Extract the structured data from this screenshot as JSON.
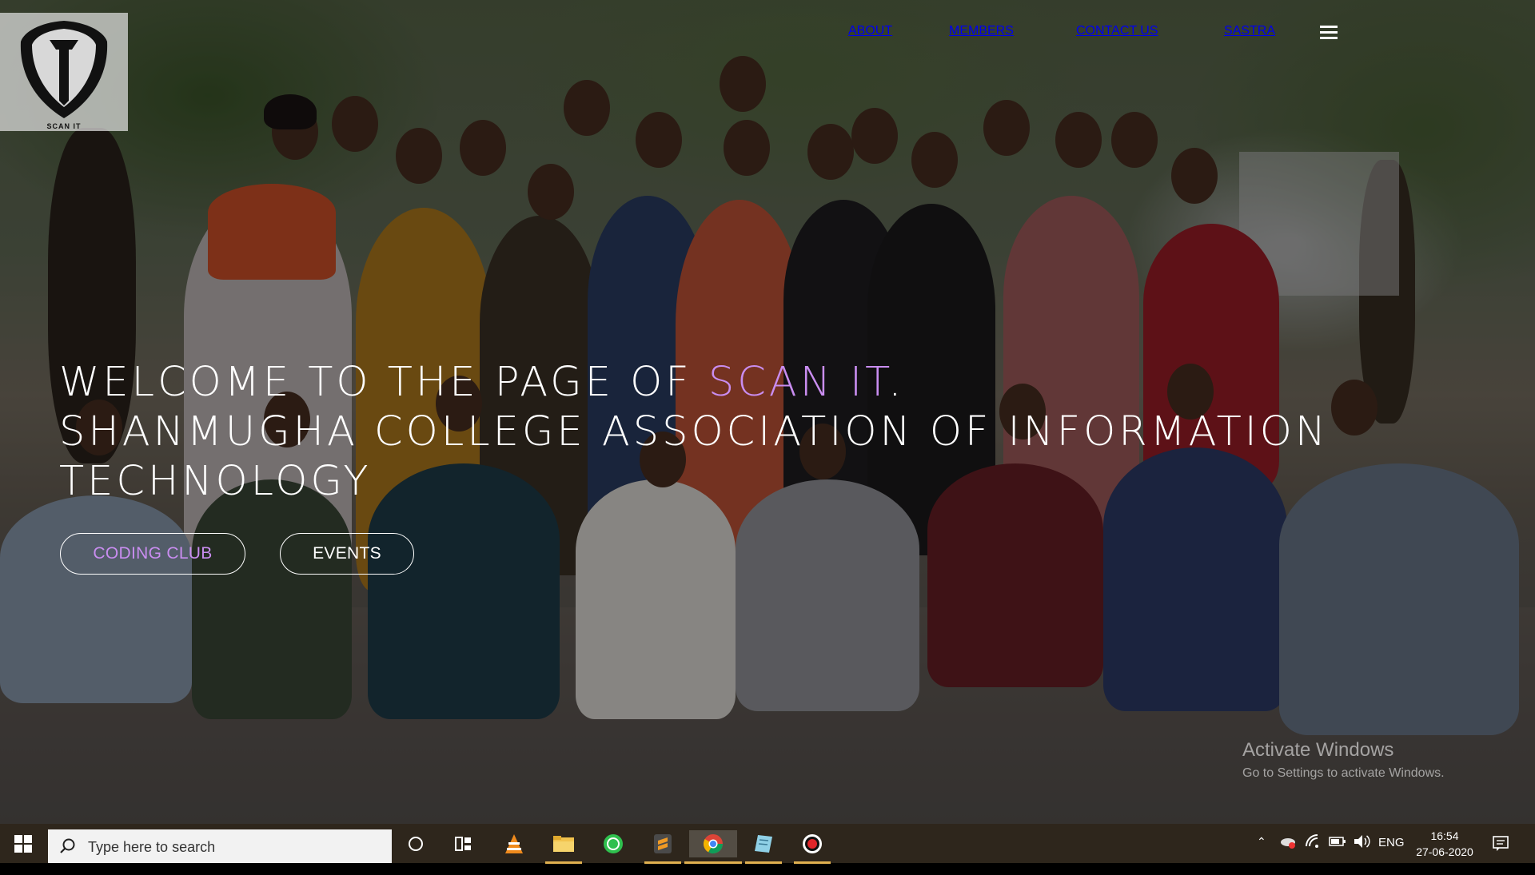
{
  "logo": {
    "text": "SCAN IT",
    "icon": "shield-logo-icon"
  },
  "nav": {
    "items": [
      {
        "label": "ABOUT"
      },
      {
        "label": "MEMBERS"
      },
      {
        "label": "CONTACT US"
      },
      {
        "label": "SASTRA"
      }
    ],
    "menu_icon": "hamburger-menu-icon"
  },
  "hero": {
    "line1_prefix": "WELCOME TO THE PAGE OF ",
    "line1_accent": "SCAN IT",
    "line1_suffix": ".",
    "line2": "SHANMUGHA COLLEGE ASSOCIATION OF INFORMATION",
    "line3": "TECHNOLOGY",
    "accent_color": "#c98df0",
    "buttons": {
      "coding": "CODING CLUB",
      "events": "EVENTS"
    }
  },
  "watermark": {
    "title": "Activate Windows",
    "subtitle": "Go to Settings to activate Windows."
  },
  "taskbar": {
    "search_placeholder": "Type here to search",
    "apps": [
      "cortana-icon",
      "task-view-icon",
      "vlc-icon",
      "file-explorer-icon",
      "whatsapp-icon",
      "sublime-text-icon",
      "chrome-icon",
      "notepad-icon",
      "screen-recorder-icon"
    ],
    "language": "ENG",
    "time": "16:54",
    "date": "27-06-2020"
  }
}
